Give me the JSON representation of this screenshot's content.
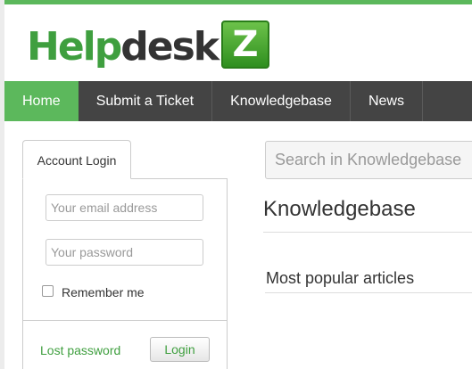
{
  "logo": {
    "part1": "Help",
    "part2": "desk",
    "badge": "Z",
    "accent": "#5cb85c"
  },
  "nav": {
    "items": [
      {
        "label": "Home",
        "active": true
      },
      {
        "label": "Submit a Ticket",
        "active": false
      },
      {
        "label": "Knowledgebase",
        "active": false
      },
      {
        "label": "News",
        "active": false
      }
    ]
  },
  "login": {
    "tab_label": "Account Login",
    "email_placeholder": "Your email address",
    "password_placeholder": "Your password",
    "remember_label": "Remember me",
    "remember_checked": false,
    "lost_password": "Lost password",
    "login_button": "Login"
  },
  "search": {
    "placeholder": "Search in Knowledgebase"
  },
  "main": {
    "title": "Knowledgebase",
    "popular_heading": "Most popular articles"
  }
}
